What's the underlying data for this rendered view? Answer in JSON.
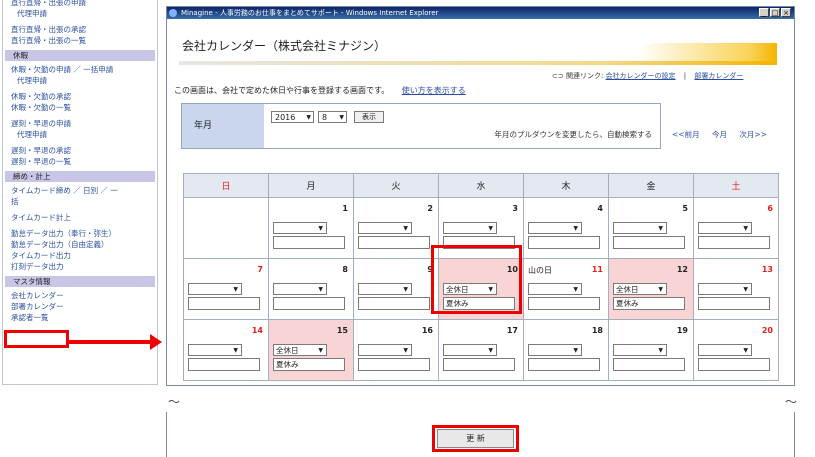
{
  "sidebar": {
    "items_top": [
      {
        "label": "直行直帰・出張の申請",
        "indent": false
      },
      {
        "label": "代理申請",
        "indent": true
      },
      {
        "label": "直行直帰・出張の承認",
        "indent": false,
        "gap": true
      },
      {
        "label": "直行直帰・出張の一覧",
        "indent": false
      }
    ],
    "section_leave": "休暇",
    "items_leave": [
      {
        "label": "休暇・欠勤の申請 ／ 一括申請",
        "indent": false
      },
      {
        "label": "代理申請",
        "indent": true
      },
      {
        "label": "休暇・欠勤の承認",
        "indent": false,
        "gap": true
      },
      {
        "label": "休暇・欠勤の一覧",
        "indent": false
      },
      {
        "label": "遅刻・早退の申請",
        "indent": false,
        "gap": true
      },
      {
        "label": "代理申請",
        "indent": true
      },
      {
        "label": "遅刻・早退の承認",
        "indent": false,
        "gap": true
      },
      {
        "label": "遅刻・早退の一覧",
        "indent": false
      }
    ],
    "section_close": "締め・計上",
    "items_close": [
      {
        "label": "タイムカード締め ／ 日別 ／ 一",
        "indent": false
      },
      {
        "label": "括",
        "indent": false
      },
      {
        "label": "タイムカード計上",
        "indent": false,
        "gap": true
      },
      {
        "label": "勤怠データ出力（奉行・弥生）",
        "indent": false,
        "gap": true
      },
      {
        "label": "勤怠データ出力（自由定義）",
        "indent": false
      },
      {
        "label": "タイムカード出力",
        "indent": false
      },
      {
        "label": "打刻データ出力",
        "indent": false
      }
    ],
    "section_master": "マスタ情報",
    "items_master": [
      {
        "label": "会社カレンダー",
        "indent": false
      },
      {
        "label": "部署カレンダー",
        "indent": false
      },
      {
        "label": "承認者一覧",
        "indent": false
      }
    ]
  },
  "window": {
    "title": "Minagine - 人事労務のお仕事をまとめてサポート - Windows Internet Explorer",
    "controls": [
      "_",
      "□",
      "×"
    ]
  },
  "page": {
    "title": "会社カレンダー（株式会社ミナジン）",
    "related_prefix": "関連リンク:",
    "related_link_1": "会社カレンダーの設定",
    "related_sep": "|",
    "related_link_2": "部署カレンダー",
    "intro": "この画面は、会社で定めた休日や行事を登録する画面です。",
    "howto_link": "使い方を表示する"
  },
  "yearmonth": {
    "label": "年月",
    "year": "2016",
    "month": "8",
    "show_button": "表示",
    "note": "年月のプルダウンを変更したら、自動検索する",
    "prev": "<<前月",
    "current": "今月",
    "next": "次月>>"
  },
  "calendar": {
    "weekdays": [
      "日",
      "月",
      "火",
      "水",
      "木",
      "金",
      "土"
    ],
    "weeks": [
      [
        {
          "day": "",
          "empty": true
        },
        {
          "day": "1"
        },
        {
          "day": "2"
        },
        {
          "day": "3"
        },
        {
          "day": "4"
        },
        {
          "day": "5"
        },
        {
          "day": "6",
          "red": true
        }
      ],
      [
        {
          "day": "7",
          "red": true
        },
        {
          "day": "8"
        },
        {
          "day": "9"
        },
        {
          "day": "10",
          "holiday": true,
          "select": "全休日",
          "text": "夏休み"
        },
        {
          "day": "11",
          "red": true,
          "holiday_name": "山の日"
        },
        {
          "day": "12",
          "holiday": true,
          "select": "全休日",
          "text": "夏休み"
        },
        {
          "day": "13",
          "red": true
        }
      ],
      [
        {
          "day": "14",
          "red": true
        },
        {
          "day": "15",
          "holiday": true,
          "select": "全休日",
          "text": "夏休み"
        },
        {
          "day": "16"
        },
        {
          "day": "17"
        },
        {
          "day": "18"
        },
        {
          "day": "19"
        },
        {
          "day": "20",
          "red": true
        }
      ]
    ]
  },
  "footer": {
    "update_button": "更 新"
  },
  "colors": {
    "highlight": "#ee0000",
    "holiday_bg": "#f8d4d4",
    "link": "#2b4fa0"
  }
}
